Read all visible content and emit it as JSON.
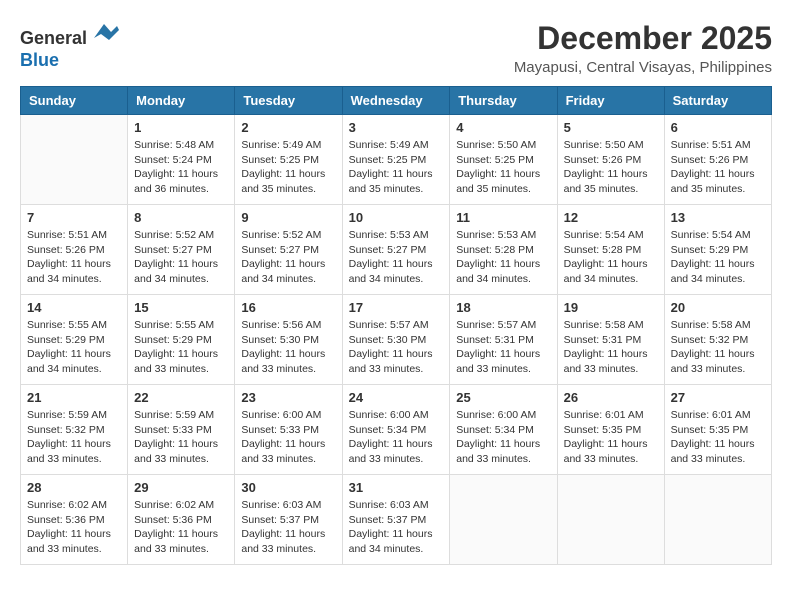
{
  "header": {
    "logo_line1": "General",
    "logo_line2": "Blue",
    "month_title": "December 2025",
    "location": "Mayapusi, Central Visayas, Philippines"
  },
  "weekdays": [
    "Sunday",
    "Monday",
    "Tuesday",
    "Wednesday",
    "Thursday",
    "Friday",
    "Saturday"
  ],
  "weeks": [
    [
      {
        "day": "",
        "info": ""
      },
      {
        "day": "1",
        "info": "Sunrise: 5:48 AM\nSunset: 5:24 PM\nDaylight: 11 hours\nand 36 minutes."
      },
      {
        "day": "2",
        "info": "Sunrise: 5:49 AM\nSunset: 5:25 PM\nDaylight: 11 hours\nand 35 minutes."
      },
      {
        "day": "3",
        "info": "Sunrise: 5:49 AM\nSunset: 5:25 PM\nDaylight: 11 hours\nand 35 minutes."
      },
      {
        "day": "4",
        "info": "Sunrise: 5:50 AM\nSunset: 5:25 PM\nDaylight: 11 hours\nand 35 minutes."
      },
      {
        "day": "5",
        "info": "Sunrise: 5:50 AM\nSunset: 5:26 PM\nDaylight: 11 hours\nand 35 minutes."
      },
      {
        "day": "6",
        "info": "Sunrise: 5:51 AM\nSunset: 5:26 PM\nDaylight: 11 hours\nand 35 minutes."
      }
    ],
    [
      {
        "day": "7",
        "info": "Sunrise: 5:51 AM\nSunset: 5:26 PM\nDaylight: 11 hours\nand 34 minutes."
      },
      {
        "day": "8",
        "info": "Sunrise: 5:52 AM\nSunset: 5:27 PM\nDaylight: 11 hours\nand 34 minutes."
      },
      {
        "day": "9",
        "info": "Sunrise: 5:52 AM\nSunset: 5:27 PM\nDaylight: 11 hours\nand 34 minutes."
      },
      {
        "day": "10",
        "info": "Sunrise: 5:53 AM\nSunset: 5:27 PM\nDaylight: 11 hours\nand 34 minutes."
      },
      {
        "day": "11",
        "info": "Sunrise: 5:53 AM\nSunset: 5:28 PM\nDaylight: 11 hours\nand 34 minutes."
      },
      {
        "day": "12",
        "info": "Sunrise: 5:54 AM\nSunset: 5:28 PM\nDaylight: 11 hours\nand 34 minutes."
      },
      {
        "day": "13",
        "info": "Sunrise: 5:54 AM\nSunset: 5:29 PM\nDaylight: 11 hours\nand 34 minutes."
      }
    ],
    [
      {
        "day": "14",
        "info": "Sunrise: 5:55 AM\nSunset: 5:29 PM\nDaylight: 11 hours\nand 34 minutes."
      },
      {
        "day": "15",
        "info": "Sunrise: 5:55 AM\nSunset: 5:29 PM\nDaylight: 11 hours\nand 33 minutes."
      },
      {
        "day": "16",
        "info": "Sunrise: 5:56 AM\nSunset: 5:30 PM\nDaylight: 11 hours\nand 33 minutes."
      },
      {
        "day": "17",
        "info": "Sunrise: 5:57 AM\nSunset: 5:30 PM\nDaylight: 11 hours\nand 33 minutes."
      },
      {
        "day": "18",
        "info": "Sunrise: 5:57 AM\nSunset: 5:31 PM\nDaylight: 11 hours\nand 33 minutes."
      },
      {
        "day": "19",
        "info": "Sunrise: 5:58 AM\nSunset: 5:31 PM\nDaylight: 11 hours\nand 33 minutes."
      },
      {
        "day": "20",
        "info": "Sunrise: 5:58 AM\nSunset: 5:32 PM\nDaylight: 11 hours\nand 33 minutes."
      }
    ],
    [
      {
        "day": "21",
        "info": "Sunrise: 5:59 AM\nSunset: 5:32 PM\nDaylight: 11 hours\nand 33 minutes."
      },
      {
        "day": "22",
        "info": "Sunrise: 5:59 AM\nSunset: 5:33 PM\nDaylight: 11 hours\nand 33 minutes."
      },
      {
        "day": "23",
        "info": "Sunrise: 6:00 AM\nSunset: 5:33 PM\nDaylight: 11 hours\nand 33 minutes."
      },
      {
        "day": "24",
        "info": "Sunrise: 6:00 AM\nSunset: 5:34 PM\nDaylight: 11 hours\nand 33 minutes."
      },
      {
        "day": "25",
        "info": "Sunrise: 6:00 AM\nSunset: 5:34 PM\nDaylight: 11 hours\nand 33 minutes."
      },
      {
        "day": "26",
        "info": "Sunrise: 6:01 AM\nSunset: 5:35 PM\nDaylight: 11 hours\nand 33 minutes."
      },
      {
        "day": "27",
        "info": "Sunrise: 6:01 AM\nSunset: 5:35 PM\nDaylight: 11 hours\nand 33 minutes."
      }
    ],
    [
      {
        "day": "28",
        "info": "Sunrise: 6:02 AM\nSunset: 5:36 PM\nDaylight: 11 hours\nand 33 minutes."
      },
      {
        "day": "29",
        "info": "Sunrise: 6:02 AM\nSunset: 5:36 PM\nDaylight: 11 hours\nand 33 minutes."
      },
      {
        "day": "30",
        "info": "Sunrise: 6:03 AM\nSunset: 5:37 PM\nDaylight: 11 hours\nand 33 minutes."
      },
      {
        "day": "31",
        "info": "Sunrise: 6:03 AM\nSunset: 5:37 PM\nDaylight: 11 hours\nand 34 minutes."
      },
      {
        "day": "",
        "info": ""
      },
      {
        "day": "",
        "info": ""
      },
      {
        "day": "",
        "info": ""
      }
    ]
  ]
}
